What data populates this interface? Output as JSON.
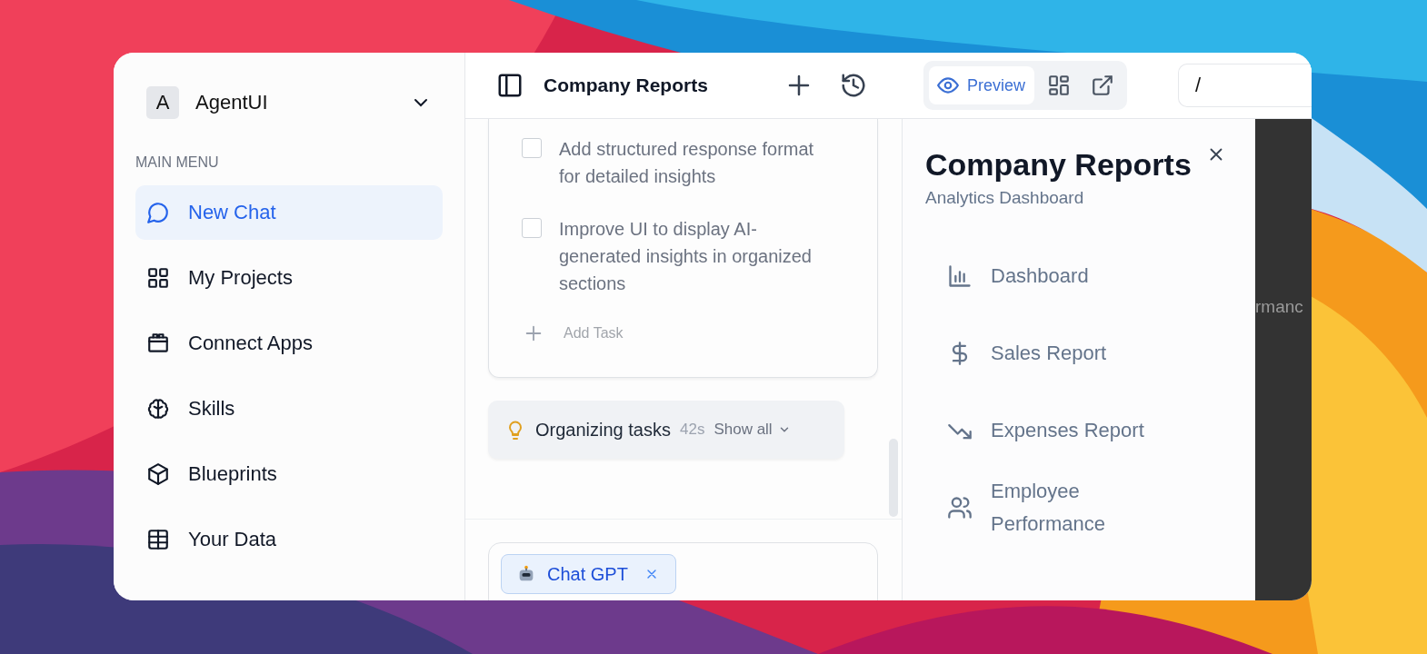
{
  "sidebar": {
    "brand": {
      "initial": "A",
      "name": "AgentUI"
    },
    "section_title": "MAIN MENU",
    "items": [
      {
        "label": "New Chat",
        "selected": true
      },
      {
        "label": "My Projects",
        "selected": false
      },
      {
        "label": "Connect Apps",
        "selected": false
      },
      {
        "label": "Skills",
        "selected": false
      },
      {
        "label": "Blueprints",
        "selected": false
      },
      {
        "label": "Your Data",
        "selected": false
      }
    ]
  },
  "toolbar": {
    "title": "Company Reports",
    "view_switch": [
      {
        "kind": "preview",
        "label": "Preview",
        "selected": true
      },
      {
        "kind": "grid",
        "selected": false
      },
      {
        "kind": "external",
        "selected": false
      }
    ],
    "address": {
      "value": "/"
    }
  },
  "tasks": {
    "items": [
      {
        "text": "Add structured response format for detailed insights",
        "checked": false
      },
      {
        "text": "Improve UI to display AI-generated insights in organized sections",
        "checked": false
      }
    ],
    "add_label": "Add Task"
  },
  "status": {
    "text": "Organizing tasks",
    "elapsed": "42s",
    "toggle": "Show all"
  },
  "composer": {
    "chip": {
      "label": "Chat GPT"
    }
  },
  "report_panel": {
    "title": "Company Reports",
    "subtitle": "Analytics Dashboard",
    "items": [
      {
        "label": "Dashboard"
      },
      {
        "label": "Sales Report"
      },
      {
        "label": "Expenses Report"
      },
      {
        "label": "Employee Performance"
      }
    ]
  },
  "background_text": "rmanc"
}
